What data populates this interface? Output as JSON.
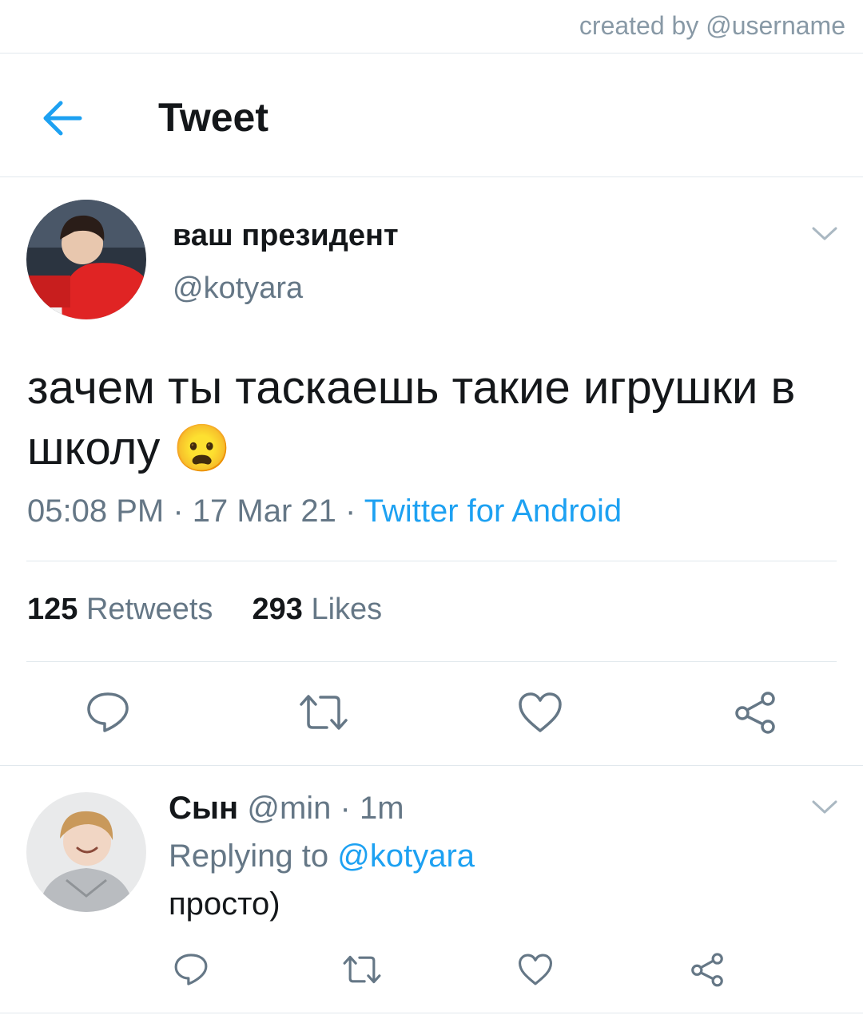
{
  "credit": "created by @username",
  "header": {
    "title": "Tweet"
  },
  "tweet": {
    "display_name": "ваш президент",
    "handle": "@kotyara",
    "text": "зачем ты таскаешь такие игрушки в школу",
    "emoji": "😦",
    "time": "05:08 PM",
    "sep": "·",
    "date": "17 Mar 21",
    "source": "Twitter for Android",
    "retweets_count": "125",
    "retweets_label": "Retweets",
    "likes_count": "293",
    "likes_label": "Likes"
  },
  "reply": {
    "display_name": "Сын",
    "handle": "@min",
    "sep": "·",
    "time": "1m",
    "replying_prefix": "Replying to",
    "replying_handle": "@kotyara",
    "text": "просто)"
  },
  "icons": [
    "back-arrow-icon",
    "chevron-down-icon",
    "reply-icon",
    "retweet-icon",
    "like-icon",
    "share-icon"
  ],
  "colors": {
    "accent": "#1da1f2",
    "muted": "#657786",
    "divider": "#e1e8ed",
    "icon": "#657786"
  }
}
